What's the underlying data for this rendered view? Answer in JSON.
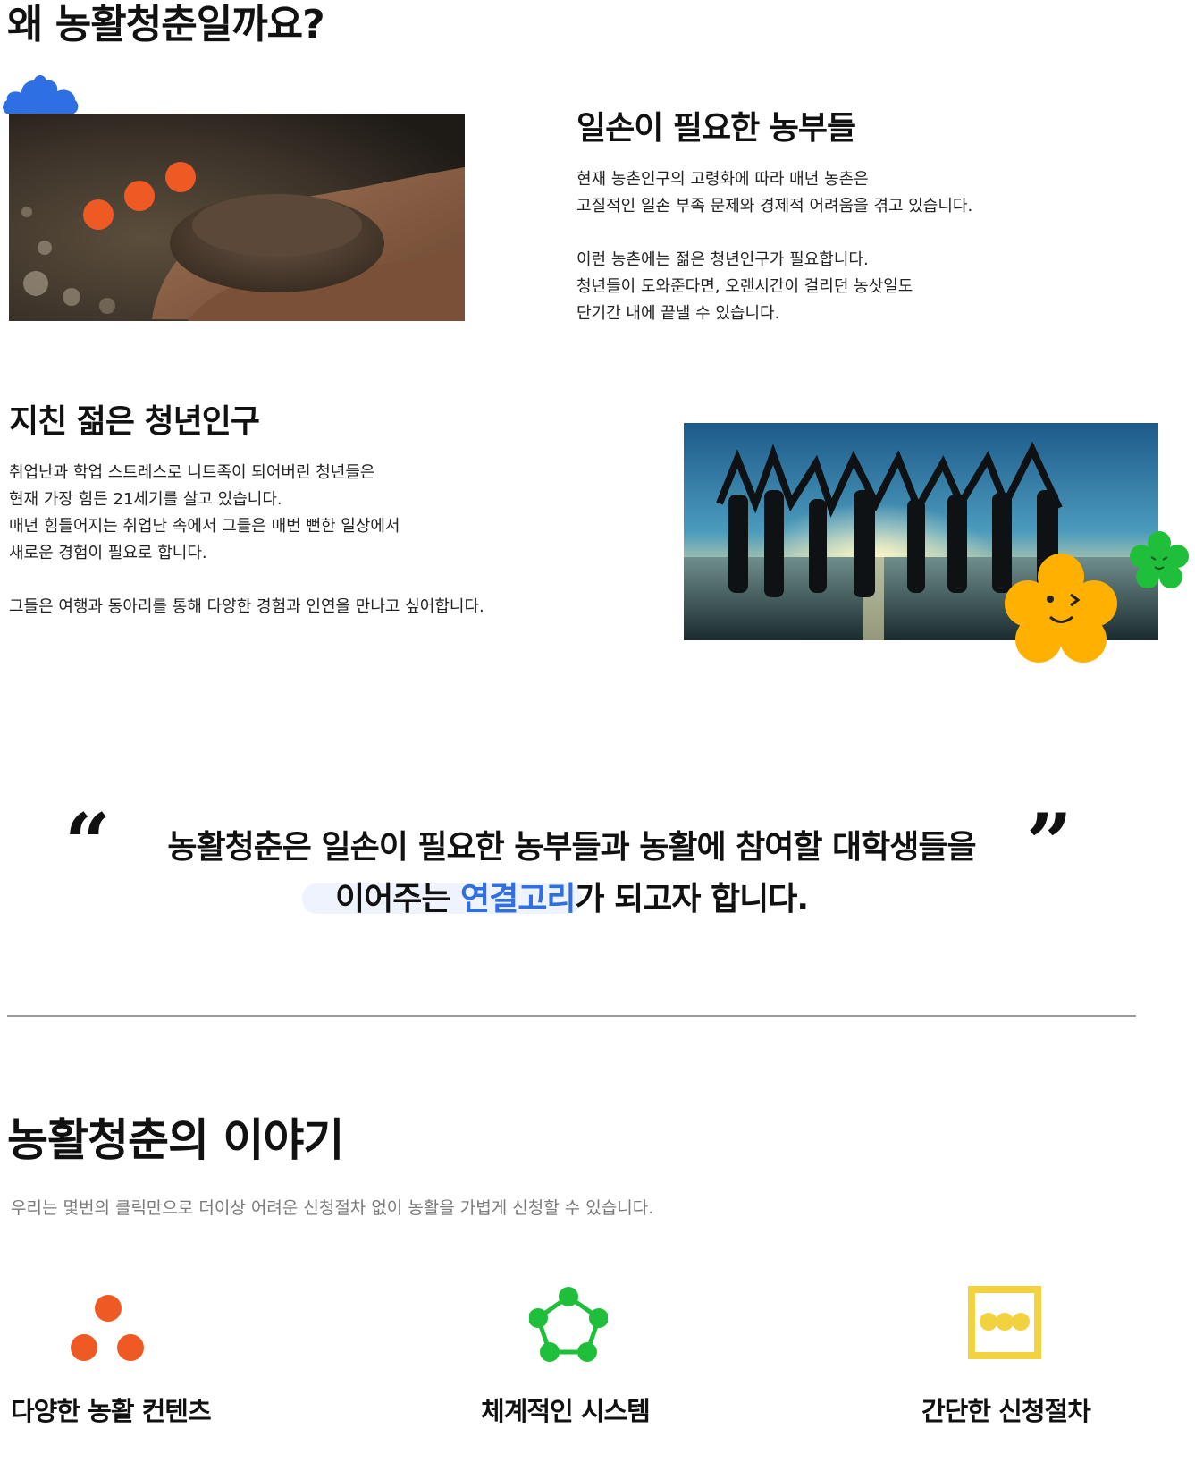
{
  "page": {
    "title": "왜 농활청춘일까요?"
  },
  "section_farmers": {
    "heading": "일손이 필요한 농부들",
    "paragraph1": [
      "현재 농촌인구의 고령화에 따라 매년 농촌은",
      "고질적인 일손 부족 문제와 경제적 어려움을 겪고 있습니다."
    ],
    "paragraph2": [
      "이런 농촌에는 젊은 청년인구가 필요합니다.",
      "청년들이 도와준다면, 오랜시간이 걸리던 농삿일도",
      "단기간 내에 끝낼 수 있습니다."
    ]
  },
  "section_youth": {
    "heading": "지친 젊은 청년인구",
    "paragraph1": [
      "취업난과 학업 스트레스로 니트족이 되어버린 청년들은",
      "현재 가장 힘든 21세기를 살고 있습니다.",
      "매년 힘들어지는 취업난 속에서 그들은 매번 뻔한 일상에서",
      "새로운 경험이 필요로 합니다."
    ],
    "paragraph2": [
      "그들은 여행과 동아리를 통해 다양한 경험과 인연을 만나고 싶어합니다."
    ]
  },
  "quote": {
    "open_mark": "“",
    "close_mark": "”",
    "line1": "농활청춘은 일손이 필요한 농부들과 농활에 참여할 대학생들을",
    "line2_before": "이어주는 ",
    "line2_highlight": "연결고리",
    "line2_after": "가 되고자 합니다."
  },
  "story": {
    "title": "농활청춘의 이야기",
    "subtitle": "우리는 몇번의 클릭만으로 더이상 어려운 신청절차 없이 농활을 가볍게 신청할 수 있습니다.",
    "features": [
      {
        "label": "다양한 농활 컨텐츠",
        "icon": "three-dots-icon",
        "color": "#ef5a24"
      },
      {
        "label": "체계적인 시스템",
        "icon": "pentagon-network-icon",
        "color": "#1fbf3b"
      },
      {
        "label": "간단한 신청절차",
        "icon": "framed-dots-icon",
        "color": "#f2d33f"
      }
    ]
  },
  "colors": {
    "accent_blue": "#2f6fe4",
    "decor_orange": "#ef5a24",
    "decor_green": "#1fbf3b",
    "decor_yellow": "#ffb000",
    "decor_cloud_blue": "#2f6fe4"
  }
}
